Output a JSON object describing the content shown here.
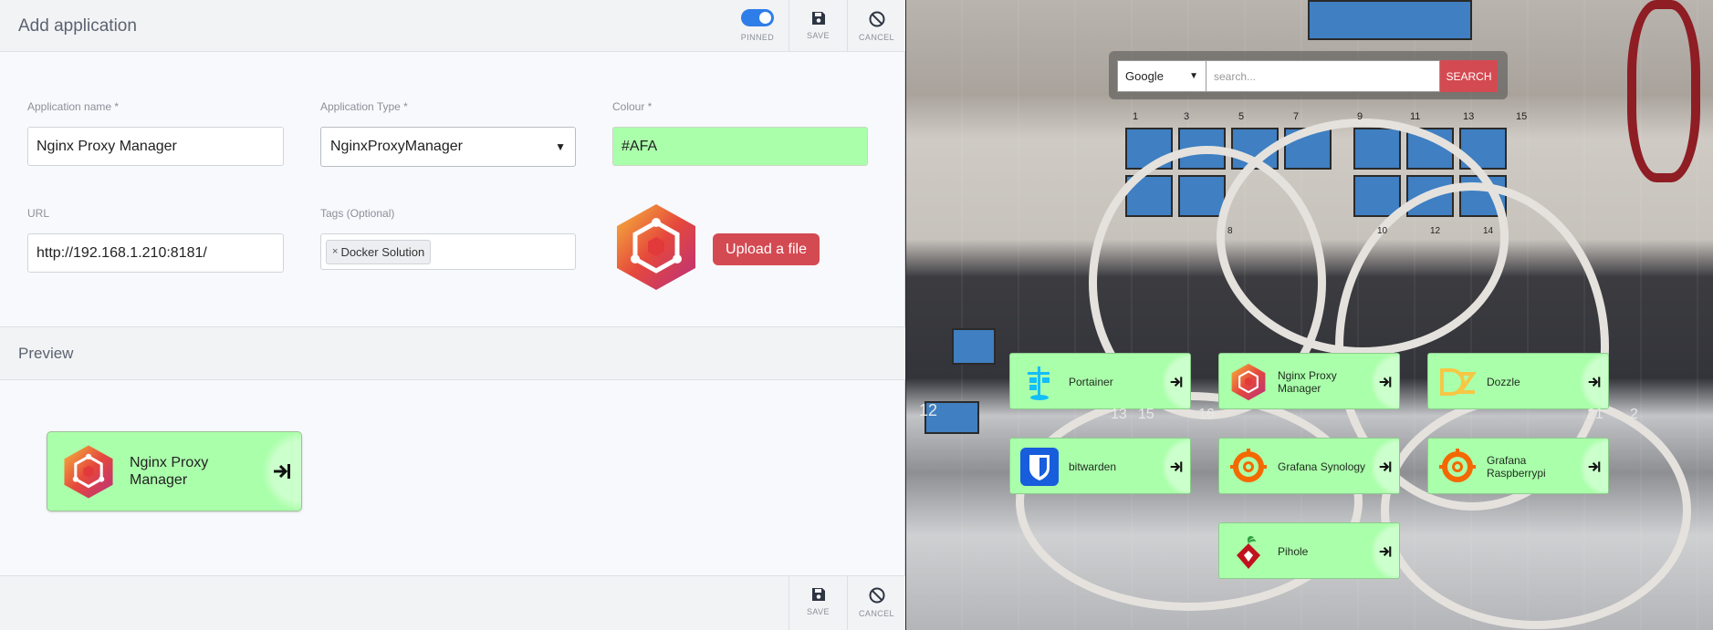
{
  "editor": {
    "title": "Add application",
    "pinned_label": "PINNED",
    "save_label": "SAVE",
    "cancel_label": "CANCEL",
    "fields": {
      "name": {
        "label": "Application name *",
        "value": "Nginx Proxy Manager"
      },
      "type": {
        "label": "Application Type *",
        "value": "NginxProxyManager"
      },
      "colour": {
        "label": "Colour *",
        "value": "#AFA"
      },
      "url": {
        "label": "URL",
        "value": "http://192.168.1.210:8181/"
      },
      "tags": {
        "label": "Tags (Optional)",
        "chips": [
          "Docker Solution"
        ]
      }
    },
    "upload_label": "Upload a file",
    "preview_title": "Preview",
    "preview_card": {
      "line1": "Nginx Proxy",
      "line2": "Manager"
    },
    "footer": {
      "save_label": "SAVE",
      "cancel_label": "CANCEL"
    }
  },
  "dashboard": {
    "search": {
      "engine": "Google",
      "placeholder": "search...",
      "button": "SEARCH"
    },
    "tiles": [
      {
        "name": "Portainer",
        "icon": "portainer-icon"
      },
      {
        "name": "Nginx Proxy Manager",
        "line1": "Nginx Proxy",
        "line2": "Manager",
        "icon": "nginx-proxy-manager-icon"
      },
      {
        "name": "Dozzle",
        "icon": "dozzle-icon"
      },
      {
        "name": "bitwarden",
        "icon": "bitwarden-icon"
      },
      {
        "name": "Grafana Synology",
        "icon": "grafana-icon"
      },
      {
        "name": "Grafana Raspberrypi",
        "line1": "Grafana",
        "line2": "Raspberrypi",
        "icon": "grafana-icon"
      },
      {
        "name": "Pihole",
        "icon": "pihole-icon"
      }
    ],
    "port_labels": [
      "1",
      "3",
      "5",
      "7",
      "9",
      "11",
      "13",
      "15",
      "8",
      "10",
      "12",
      "14",
      "12",
      "13",
      "15",
      "16",
      "21",
      "2"
    ]
  },
  "colors": {
    "accent": "#2e7de9",
    "upload": "#d44a52",
    "card": "#aaffaa"
  }
}
